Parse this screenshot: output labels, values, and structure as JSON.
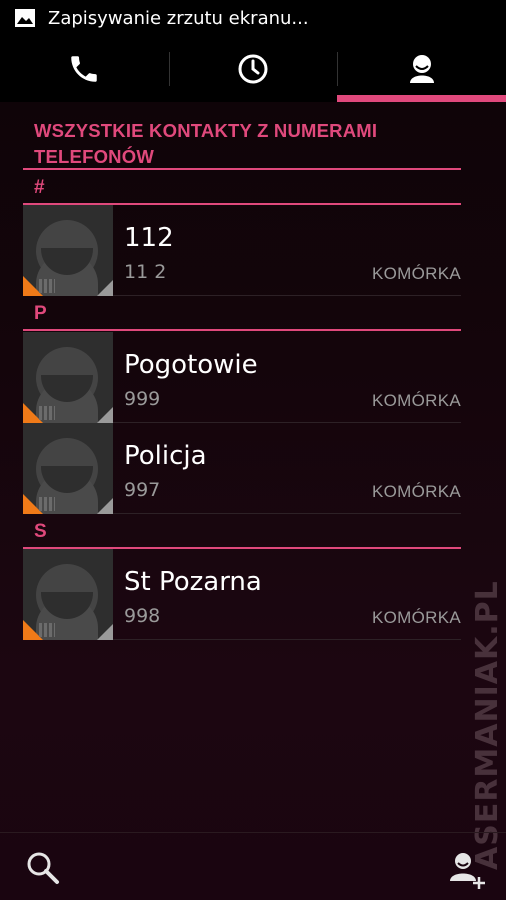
{
  "status_bar": {
    "notification_text": "Zapisywanie zrzutu ekranu...",
    "icon": "picture-icon"
  },
  "tabs": [
    {
      "name": "phone",
      "icon": "phone-icon",
      "active": false
    },
    {
      "name": "recent",
      "icon": "clock-icon",
      "active": false
    },
    {
      "name": "contacts",
      "icon": "person-icon",
      "active": true
    }
  ],
  "list_title": "WSZYSTKIE KONTAKTY Z NUMERAMI TELEFONÓW",
  "sections": [
    {
      "letter": "#",
      "contacts": [
        {
          "name": "112",
          "number": "11 2",
          "type": "KOMÓRKA"
        }
      ]
    },
    {
      "letter": "P",
      "contacts": [
        {
          "name": "Pogotowie",
          "number": "999",
          "type": "KOMÓRKA"
        },
        {
          "name": "Policja",
          "number": "997",
          "type": "KOMÓRKA"
        }
      ]
    },
    {
      "letter": "S",
      "contacts": [
        {
          "name": "St Pozarna",
          "number": "998",
          "type": "KOMÓRKA"
        }
      ]
    }
  ],
  "bottom_bar": {
    "search_icon": "search-icon",
    "add_contact_icon": "add-contact-icon"
  },
  "watermark": "ASERMANIAK.PL",
  "colors": {
    "accent": "#e0497c",
    "background": "#14050b",
    "sim_badge": "#f07a18"
  }
}
